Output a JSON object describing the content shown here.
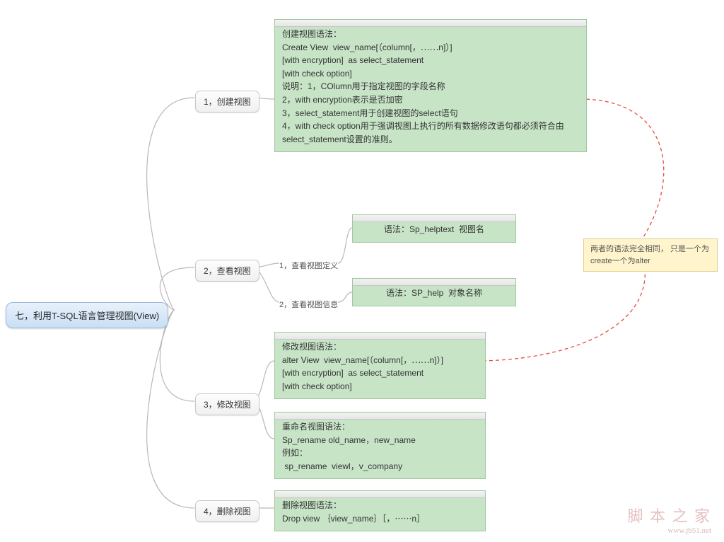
{
  "root": "七，利用T-SQL语言管理视图(View)",
  "b": {
    "1": "1，创建视图",
    "2": "2，查看视图",
    "3": "3，修改视图",
    "4": "4，删除视图"
  },
  "l": {
    "1": "1，查看视图定义",
    "2": "2，查看视图信息"
  },
  "d": {
    "1": "创建视图语法：\nCreate View  view_name[（column[，⋯⋯n]）]\n[with encryption]  as select_statement\n[with check option]\n说明：1，COlumn用于指定视图的字段名称\n2，with encryption表示是否加密\n3，select_statement用于创建视图的select语句\n4，with check option用于强调视图上执行的所有数据修改语句都必须符合由select_statement设置的准则。",
    "2": "语法：Sp_helptext  视图名",
    "3": "语法：SP_help  对象名称",
    "4": "修改视图语法：\nalter View  view_name[（column[，⋯⋯n]）]\n[with encryption]  as select_statement\n[with check option]",
    "5": "重命名视图语法：\nSp_rename old_name，new_name\n例如：\n sp_rename  viewl，v_company",
    "6": "删除视图语法：\nDrop view ｛view_name｝［，⋯⋯n］"
  },
  "note": "两者的语法完全相同，\n只是一个为create一个为alter",
  "wm": {
    "t": "脚 本 之 家",
    "u": "www.jb51.net"
  }
}
